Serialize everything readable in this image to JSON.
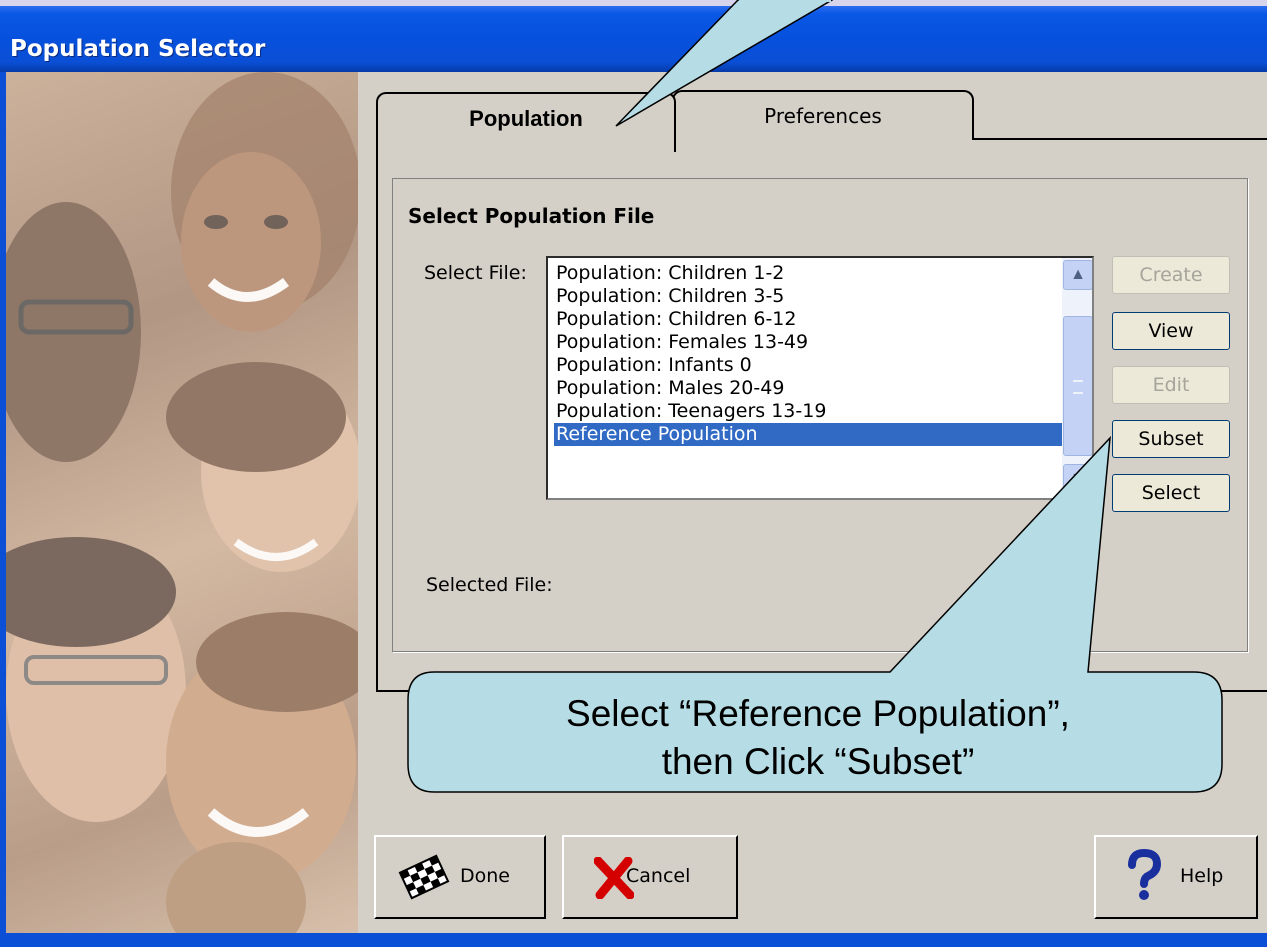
{
  "window": {
    "title": "Population Selector"
  },
  "tabs": [
    {
      "label": "Population",
      "active": true
    },
    {
      "label": "Preferences",
      "active": false
    }
  ],
  "section": {
    "title": "Select Population File",
    "select_file_label": "Select File:",
    "selected_file_label": "Selected File:"
  },
  "file_list": {
    "items": [
      "Population: Children 1-2",
      "Population: Children 3-5",
      "Population: Children 6-12",
      "Population: Females 13-49",
      "Population: Infants 0",
      "Population: Males 20-49",
      "Population: Teenagers 13-19",
      "Reference Population"
    ],
    "selected_index": 7
  },
  "side_buttons": {
    "create": "Create",
    "view": "View",
    "edit": "Edit",
    "subset": "Subset",
    "select": "Select"
  },
  "bottom_buttons": {
    "done": "Done",
    "cancel": "Cancel",
    "help": "Help"
  },
  "callout": {
    "line1": "Select “Reference Population”,",
    "line2": "then Click “Subset”"
  },
  "colors": {
    "titlebar": "#0650dc",
    "selection": "#316ac5",
    "callout_fill": "#b6dde5"
  }
}
